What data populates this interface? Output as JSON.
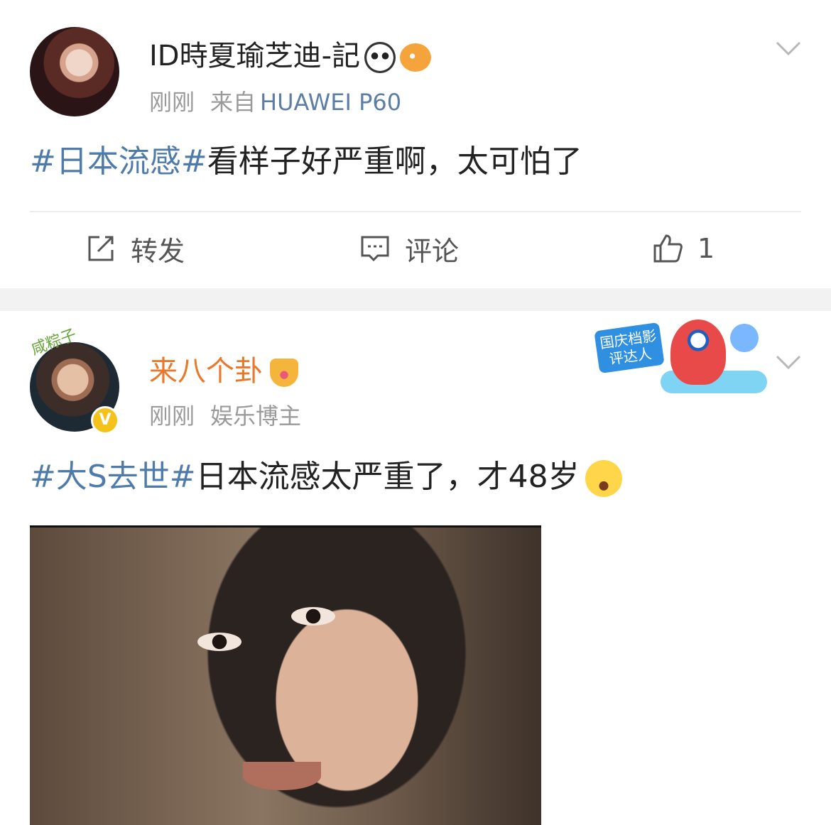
{
  "posts": [
    {
      "username": "ID時夏瑜芝迪-記",
      "time": "刚刚",
      "source_prefix": "来自",
      "source": "HUAWEI P60",
      "topic": "#日本流感#",
      "text": "看样子好严重啊，太可怕了",
      "actions": {
        "repost_label": "转发",
        "comment_label": "评论",
        "like_count": "1"
      },
      "icons": [
        "panda-emoji-icon",
        "fish-emoji-icon"
      ]
    },
    {
      "username": "来八个卦",
      "time": "刚刚",
      "role": "娱乐博主",
      "avatar_tag": "咸粽子",
      "verified_mark": "V",
      "badge_text": "国庆档影评达人",
      "topic": "#大S去世#",
      "text": "日本流感太严重了，才48岁",
      "icons": [
        "crown-icon",
        "laugh-cry-emoji-icon"
      ]
    }
  ],
  "colors": {
    "topic": "#4f7bab",
    "username_vip": "#e8782a",
    "meta": "#9a9a9a",
    "separator": "#f2f2f2"
  }
}
